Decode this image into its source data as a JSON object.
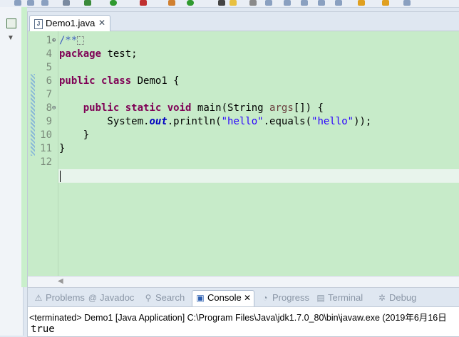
{
  "editor": {
    "tab_label": "Demo1.java",
    "line_numbers": [
      "1",
      "4",
      "5",
      "6",
      "7",
      "8",
      "9",
      "10",
      "11",
      "12"
    ],
    "lines": [
      [
        {
          "t": "/**",
          "c": "cm"
        },
        {
          "t": "",
          "c": "fb"
        }
      ],
      [
        {
          "t": "package",
          "c": "kw"
        },
        {
          "t": " test;",
          "c": ""
        }
      ],
      [],
      [
        {
          "t": "public",
          "c": "kw"
        },
        {
          "t": " ",
          "c": ""
        },
        {
          "t": "class",
          "c": "kw"
        },
        {
          "t": " Demo1 {",
          "c": ""
        }
      ],
      [],
      [
        {
          "t": "    ",
          "c": ""
        },
        {
          "t": "public",
          "c": "kw"
        },
        {
          "t": " ",
          "c": ""
        },
        {
          "t": "static",
          "c": "kw"
        },
        {
          "t": " ",
          "c": ""
        },
        {
          "t": "void",
          "c": "kw"
        },
        {
          "t": " main(String ",
          "c": ""
        },
        {
          "t": "args",
          "c": "var"
        },
        {
          "t": "[]) {",
          "c": ""
        }
      ],
      [
        {
          "t": "        System.",
          "c": ""
        },
        {
          "t": "out",
          "c": "fld"
        },
        {
          "t": ".println(",
          "c": ""
        },
        {
          "t": "\"hello\"",
          "c": "st"
        },
        {
          "t": ".equals(",
          "c": ""
        },
        {
          "t": "\"hello\"",
          "c": "st"
        },
        {
          "t": "));",
          "c": ""
        }
      ],
      [
        {
          "t": "    }",
          "c": ""
        }
      ],
      [
        {
          "t": "}",
          "c": ""
        }
      ],
      []
    ]
  },
  "bottom_panel": {
    "tabs": [
      {
        "label": "Problems",
        "icon": "⚠"
      },
      {
        "label": "Javadoc",
        "icon": "@"
      },
      {
        "label": "Search",
        "icon": "⚲"
      },
      {
        "label": "Console",
        "icon": "▣"
      },
      {
        "label": "Progress",
        "icon": "◔"
      },
      {
        "label": "Terminal",
        "icon": "▤"
      },
      {
        "label": "Debug",
        "icon": "✲"
      }
    ],
    "console_status": "<terminated> Demo1 [Java Application] C:\\Program Files\\Java\\jdk1.7.0_80\\bin\\javaw.exe (2019年6月16日",
    "console_output": "true"
  },
  "colors": {
    "editor_bg": "#c7ebc9",
    "keyword": "#7f0055",
    "string": "#2a00ff",
    "comment": "#3f5fbf"
  }
}
